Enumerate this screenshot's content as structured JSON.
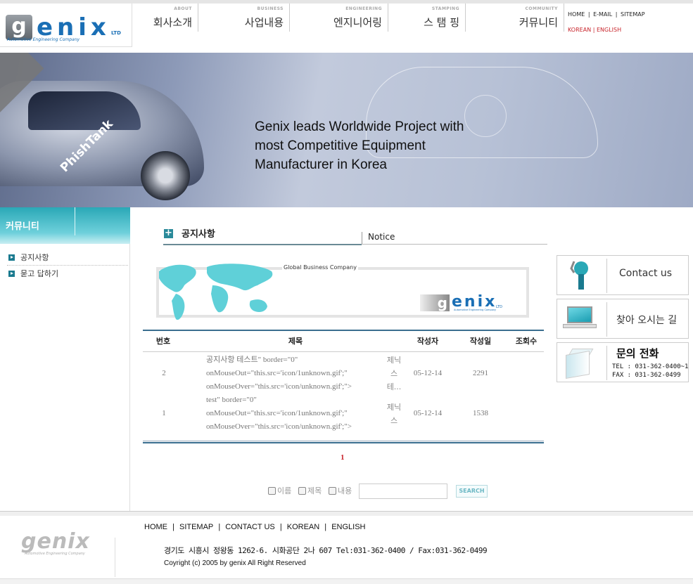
{
  "header": {
    "logo": {
      "mark": "g",
      "name": "enix",
      "ltd": "LTD",
      "tagline": "Automotive Engineering Company"
    },
    "nav": [
      {
        "en": "ABOUT",
        "ko": "회사소개"
      },
      {
        "en": "BUSINESS",
        "ko": "사업내용"
      },
      {
        "en": "ENGINEERING",
        "ko": "엔지니어링"
      },
      {
        "en": "STAMPING",
        "ko": "스 탬 핑"
      },
      {
        "en": "COMMUNITY",
        "ko": "커뮤니티"
      }
    ],
    "util": {
      "home": "HOME",
      "email": "E-MAIL",
      "sitemap": "SITEMAP",
      "sep": "|"
    },
    "lang": {
      "korean": "KOREAN",
      "english": "ENGLISH",
      "sep": "|"
    }
  },
  "banner": {
    "line1": "Genix leads Worldwide Project with",
    "line2": "most Competitive Equipment",
    "line3": "Manufacturer in Korea",
    "ribbon": "PhishTank"
  },
  "sidebar": {
    "title": "커뮤니티",
    "items": [
      {
        "label": "공지사항"
      },
      {
        "label": "묻고 답하기"
      }
    ]
  },
  "main": {
    "section_title": "공지사항",
    "section_en": "Notice",
    "banner_label": "Global Business Company",
    "banner_logo": {
      "mark": "g",
      "name": "enix",
      "ltd": "LTD",
      "tagline": "Automotive Engineering Company"
    },
    "table": {
      "headers": [
        "번호",
        "제목",
        "작성자",
        "작성일",
        "조회수"
      ],
      "rows": [
        {
          "no": "2",
          "title_lines": [
            "공지사항 테스트\" border=\"0\"",
            "onMouseOut=\"this.src='icon/1unknown.gif';\"",
            "onMouseOver=\"this.src='icon/unknown.gif';\">"
          ],
          "author_lines": [
            "제닉",
            "스",
            "테..."
          ],
          "date": "05-12-14",
          "views": "2291"
        },
        {
          "no": "1",
          "title_lines": [
            "test\" border=\"0\"",
            "onMouseOut=\"this.src='icon/1unknown.gif';\"",
            "onMouseOver=\"this.src='icon/unknown.gif';\">"
          ],
          "author_lines": [
            "제닉",
            "스"
          ],
          "date": "05-12-14",
          "views": "1538"
        }
      ]
    },
    "pagination": {
      "current": "1"
    },
    "search": {
      "opt_name": "이름",
      "opt_title": "제목",
      "opt_content": "내용",
      "input_value": "",
      "button": "SEARCH"
    }
  },
  "right_panel": {
    "contact": "Contact us",
    "directions": "찾아 오시는 길",
    "phone_title": "문의 전화",
    "tel": "TEL : 031-362-0400~1",
    "fax": "FAX : 031-362-0499"
  },
  "footer": {
    "logo": "genix",
    "logo_sub": "Automotive Engineering Company",
    "links": {
      "home": "HOME",
      "sitemap": "SITEMAP",
      "contact": "CONTACT US",
      "korean": "KOREAN",
      "english": "ENGLISH",
      "sep": "|"
    },
    "address": "경기도 시흥시 정왕동 1262-6. 시화공단 2나 607  Tel:031-362-0400 / Fax:031-362-0499",
    "copyright": "Coyright (c) 2005 by genix  All Right Reserved"
  },
  "colors": {
    "brand_blue": "#1a6fb5",
    "accent_teal": "#2aa8b6",
    "accent_red": "#c8242b"
  }
}
